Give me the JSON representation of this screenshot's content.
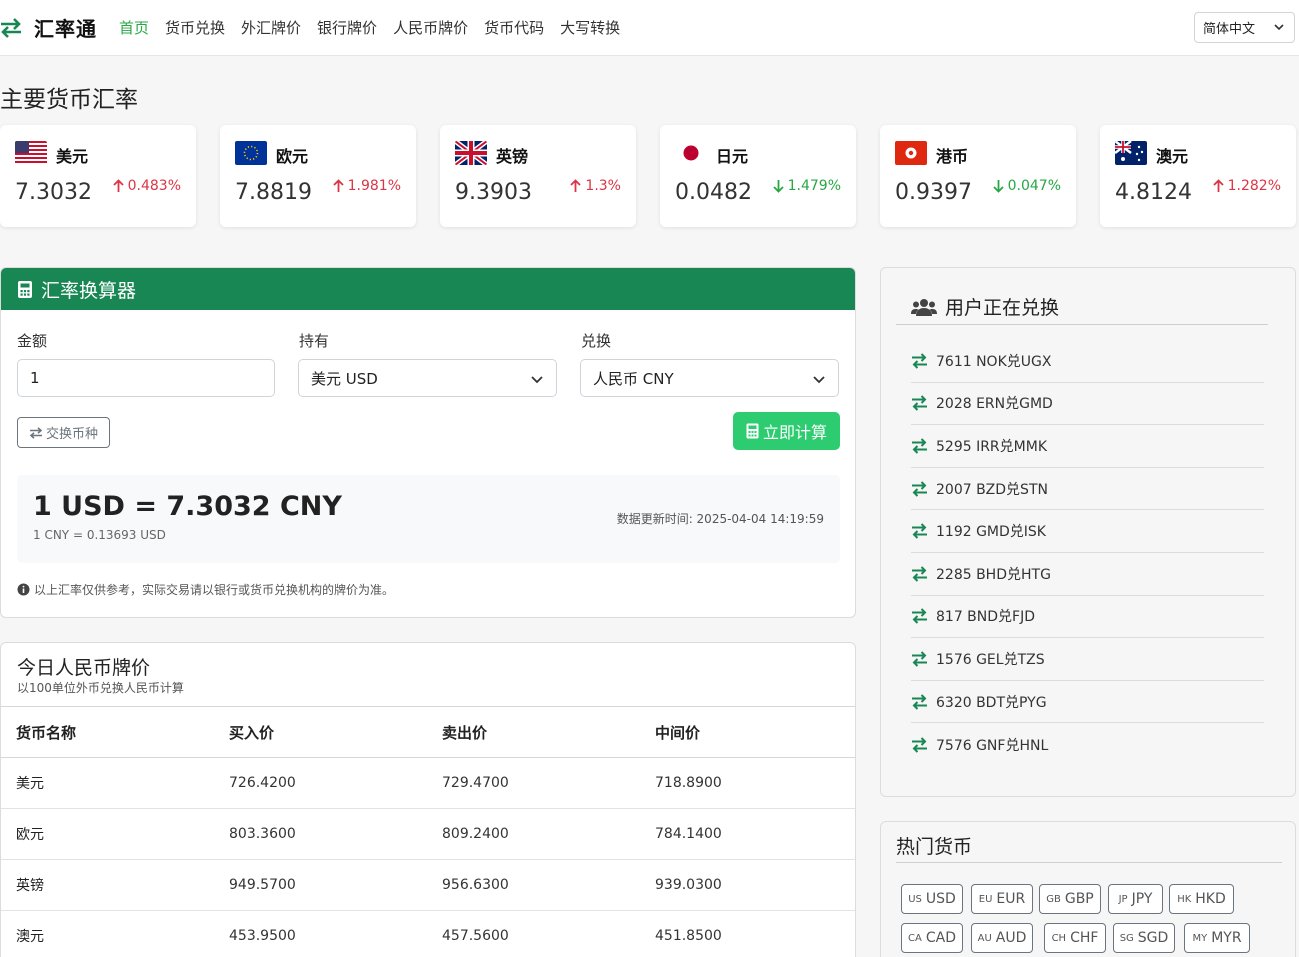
{
  "nav": {
    "brand": "汇率通",
    "links": [
      "首页",
      "货币兑换",
      "外汇牌价",
      "银行牌价",
      "人民币牌价",
      "货币代码",
      "大写转换"
    ],
    "language": "简体中文"
  },
  "main_rates": {
    "title": "主要货币汇率",
    "cards": [
      {
        "name": "美元",
        "rate": "7.3032",
        "change": "0.483%",
        "direction": "up",
        "flag": "us-flag"
      },
      {
        "name": "欧元",
        "rate": "7.8819",
        "change": "1.981%",
        "direction": "up",
        "flag": "eu-flag"
      },
      {
        "name": "英镑",
        "rate": "9.3903",
        "change": "1.3%",
        "direction": "up",
        "flag": "uk-flag"
      },
      {
        "name": "日元",
        "rate": "0.0482",
        "change": "1.479%",
        "direction": "down",
        "flag": "jp-flag"
      },
      {
        "name": "港币",
        "rate": "0.9397",
        "change": "0.047%",
        "direction": "down",
        "flag": "hk-flag"
      },
      {
        "name": "澳元",
        "rate": "4.8124",
        "change": "1.282%",
        "direction": "up",
        "flag": "au-flag"
      }
    ]
  },
  "converter": {
    "title": "汇率换算器",
    "amount_label": "金额",
    "amount_value": "1",
    "from_label": "持有",
    "from_value": "美元 USD",
    "to_label": "兑换",
    "to_value": "人民币 CNY",
    "swap_label": "交换币种",
    "calc_label": "立即计算",
    "result_main": "1 USD = 7.3032 CNY",
    "result_sub": "1 CNY = 0.13693 USD",
    "update_time": "数据更新时间: 2025-04-04 14:19:59",
    "disclaimer": "以上汇率仅供参考，实际交易请以银行或货币兑换机构的牌价为准。"
  },
  "rmb_table": {
    "title": "今日人民币牌价",
    "subtitle": "以100单位外币兑换人民币计算",
    "headers": [
      "货币名称",
      "买入价",
      "卖出价",
      "中间价"
    ],
    "rows": [
      [
        "美元",
        "726.4200",
        "729.4700",
        "718.8900"
      ],
      [
        "欧元",
        "803.3600",
        "809.2400",
        "784.1400"
      ],
      [
        "英镑",
        "949.5700",
        "956.6300",
        "939.0300"
      ],
      [
        "澳元",
        "453.9500",
        "457.5600",
        "451.8500"
      ]
    ]
  },
  "users_converting": {
    "title": "用户正在兑换",
    "items": [
      "7611 NOK兑UGX",
      "2028 ERN兑GMD",
      "5295 IRR兑MMK",
      "2007 BZD兑STN",
      "1192 GMD兑ISK",
      "2285 BHD兑HTG",
      "817 BND兑FJD",
      "1576 GEL兑TZS",
      "6320 BDT兑PYG",
      "7576 GNF兑HNL"
    ]
  },
  "hot_currencies": {
    "title": "热门货币",
    "tags": [
      {
        "region": "US",
        "code": "USD"
      },
      {
        "region": "EU",
        "code": "EUR"
      },
      {
        "region": "GB",
        "code": "GBP"
      },
      {
        "region": "JP",
        "code": "JPY"
      },
      {
        "region": "HK",
        "code": "HKD"
      },
      {
        "region": "CA",
        "code": "CAD"
      },
      {
        "region": "AU",
        "code": "AUD"
      },
      {
        "region": "CH",
        "code": "CHF"
      },
      {
        "region": "SG",
        "code": "SGD"
      },
      {
        "region": "MY",
        "code": "MYR"
      }
    ]
  },
  "colors": {
    "primary_green": "#198754",
    "button_green": "#2ecc71",
    "up_red": "#dc3545",
    "down_green": "#28a745"
  }
}
